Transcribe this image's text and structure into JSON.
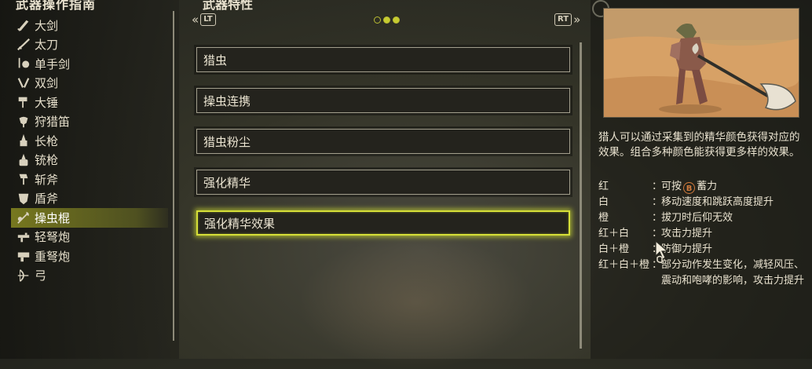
{
  "left_panel": {
    "title": "武器操作指南",
    "items": [
      {
        "label": "大剑",
        "icon": "great-sword-icon"
      },
      {
        "label": "太刀",
        "icon": "long-sword-icon"
      },
      {
        "label": "单手剑",
        "icon": "sword-and-shield-icon"
      },
      {
        "label": "双剑",
        "icon": "dual-blades-icon"
      },
      {
        "label": "大锤",
        "icon": "hammer-icon"
      },
      {
        "label": "狩猎笛",
        "icon": "hunting-horn-icon"
      },
      {
        "label": "长枪",
        "icon": "lance-icon"
      },
      {
        "label": "铳枪",
        "icon": "gunlance-icon"
      },
      {
        "label": "斩斧",
        "icon": "switch-axe-icon"
      },
      {
        "label": "盾斧",
        "icon": "charge-blade-icon"
      },
      {
        "label": "操虫棍",
        "icon": "insect-glaive-icon",
        "selected": true
      },
      {
        "label": "轻弩炮",
        "icon": "light-bowgun-icon"
      },
      {
        "label": "重弩炮",
        "icon": "heavy-bowgun-icon"
      },
      {
        "label": "弓",
        "icon": "bow-icon"
      }
    ]
  },
  "middle_panel": {
    "title": "武器特性",
    "nav_prev_badge": "LT",
    "nav_next_badge": "RT",
    "nav_prev_arrow": "«",
    "nav_next_arrow": "»",
    "page_dots": {
      "total": 3,
      "active": [
        1,
        2
      ]
    },
    "traits": [
      {
        "label": "猎虫"
      },
      {
        "label": "操虫连携"
      },
      {
        "label": "猎虫粉尘"
      },
      {
        "label": "强化精华"
      },
      {
        "label": "强化精华效果",
        "selected": true
      }
    ]
  },
  "right_panel": {
    "description": "猎人可以通过采集到的精华颜色获得对应的效果。组合多种颜色能获得更多样的效果。",
    "effects": [
      {
        "color": "红",
        "text_pre": "可按",
        "button": "B",
        "text_post": "蓄力"
      },
      {
        "color": "白",
        "text": "移动速度和跳跃高度提升"
      },
      {
        "color": "橙",
        "text": "拔刀时后仰无效"
      },
      {
        "color": "红＋白",
        "text": "攻击力提升"
      },
      {
        "color": "白＋橙",
        "text": "防御力提升"
      },
      {
        "color": "红＋白＋橙",
        "text": "部分动作发生变化，减轻风压、震动和咆哮的影响，攻击力提升"
      }
    ],
    "colon": "："
  },
  "colors": {
    "highlight": "#d6df38",
    "button_b": "#d07a3c"
  }
}
